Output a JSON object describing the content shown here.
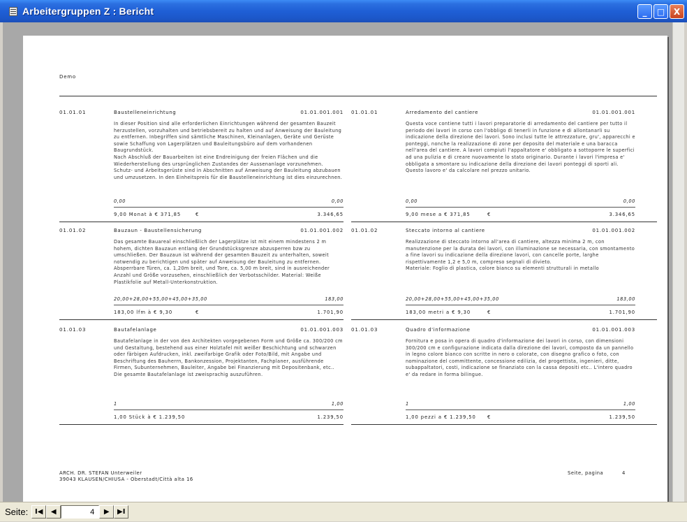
{
  "window": {
    "title": "Arbeitergruppen Z : Bericht",
    "buttons": {
      "minimize": "_",
      "maximize": "□",
      "close": "X"
    }
  },
  "report": {
    "header": "Demo",
    "rows": [
      {
        "left": {
          "code": "01.01.01",
          "title": "Baustelleneinrichtung",
          "ref": "01.01.001.001",
          "description": "In dieser Position sind alle erforderlichen Einrichtungen während der gesamten Bauzeit herzustellen, vorzuhalten und betriebsbereit zu halten und auf Anweisung der Bauleitung zu entfernen. Inbegriffen sind sämtliche Maschinen, Kleinanlagen, Geräte und Gerüste sowie Schaffung von Lagerplätzen und Bauleitungsbüro auf dem vorhandenen Baugrundstück.\nNach Abschluß der Bauarbeiten ist eine Endreinigung der freien Flächen und die Wiederherstellung des ursprünglichen Zustandes der Aussenanlage vorzunehmen. Schutz- und Arbeitsgerüste sind in Abschnitten auf Anweisung der Bauleitung abzubauen und umzusetzen. In den Einheitspreis für die Baustelleneinrichtung ist dies einzurechnen.",
          "calc": "0,00",
          "calc_value": "0,00",
          "summary": "9,00  Monat  à €  371,85",
          "euro": "€",
          "total": "3.346,65"
        },
        "right": {
          "code": "01.01.01",
          "title": "Arredamento del cantiere",
          "ref": "01.01.001.001",
          "description": "Questa voce contiene tutti i lavori preparatorie di arredamento del cantiere per tutto il periodo dei lavori in corso con l'obbligo di tenerli in funzione e di allontanarli su indicazione della direzione dei lavori. Sono inclusi tutte le attrezzature, gru', apparecchi e ponteggi, nonche la realizzazione di zone per deposito del materiale e una baracca nell'area del cantiere. A lavori compiuti l'appaltatore e' obbligato a sottoporre le superfici ad una pulizia e di creare nuovamente lo stato originario. Durante i lavori l'impresa e' obbligata a smontare su indicazione della direzione dei lavori ponteggi di sporti ali. Questo lavoro e' da calcolare nel prezzo unitario.",
          "calc": "0,00",
          "calc_value": "0,00",
          "summary": "9,00  mese  a €  371,85",
          "euro": "€",
          "total": "3.346,65"
        }
      },
      {
        "left": {
          "code": "01.01.02",
          "title": "Bauzaun - Baustellensicherung",
          "ref": "01.01.001.002",
          "description": "Das gesamte Bauareal einschließlich der Lagerplätze ist mit einem mindestens 2 m hohem, dichten Bauzaun entlang der Grundstücksgrenze abzusperren bzw zu umschließen. Der Bauzaun ist während der gesamten Bauzeit zu unterhalten, soweit notwendig zu berichtigen und später auf Anweisung der Bauleitung zu entfernen. Absperrbare Türen, ca. 1,20m breit, und Tore, ca. 5,00 m breit, sind in ausreichender Anzahl und Größe vorzusehen, einschließlich der Verbotsschilder. Material: Weiße Plastikfolie auf Metall-Unterkonstruktion.",
          "calc": "20,00+28,00+55,00+45,00+35,00",
          "calc_value": "183,00",
          "summary": "183,00  lfm  à €  9,30",
          "euro": "€",
          "total": "1.701,90"
        },
        "right": {
          "code": "01.01.02",
          "title": "Steccato intorno al cantiere",
          "ref": "01.01.001.002",
          "description": "Realizzazione di steccato intorno all'area di cantiere, altezza minima 2 m, con manutenzione per la durata dei lavori, con illuminazione se necessaria, con smontamento a fine lavori su indicazione della direzione lavori, con cancelle porte, larghe rispettivamente 1,2 e 5,0 m, compreso segnali di divieto.\nMateriale: Foglio di plastica, colore bianco su elementi strutturali in metallo",
          "calc": "20,00+28,00+55,00+45,00+35,00",
          "calc_value": "183,00",
          "summary": "183,00  metri  a €  9,30",
          "euro": "€",
          "total": "1.701,90"
        }
      },
      {
        "left": {
          "code": "01.01.03",
          "title": "Bautafelanlage",
          "ref": "01.01.001.003",
          "description": "Bautafelanlage in der von den Architekten vorgegebenen Form und Größe ca. 300/200 cm und Gestaltung, bestehend aus einer Holztafel mit weißer Beschichtung und schwarzen oder färbigen Aufdrucken, inkl. zweifarbige Grafik oder Foto/Bild, mit Angabe und Beschriftung des Bauherrn, Bankonzession, Projektanten, Fachplaner, ausführende Firmen, Subunternehmen, Bauleiter, Angabe bei Finanzierung mit Depositenbank, etc.. Die gesamte Bautafelanlage ist zweisprachig auszuführen.",
          "calc": "1",
          "calc_value": "1,00",
          "summary": "1,00  Stück  à €  1.239,50",
          "euro": "",
          "total": "1.239,50"
        },
        "right": {
          "code": "01.01.03",
          "title": "Quadro d'informazione",
          "ref": "01.01.001.003",
          "description": "Fornitura e posa in opera di quadro d'informazione dei lavori in corso, con dimensioni 300/200 cm e configurazione indicata dalla direzione dei lavori, composto da un pannello in legno colore bianco con scritte in nero o colorate, con disegno grafico o foto, con nominazione del committente, concessione edilizia, del progettista, ingenieri, ditte, subappaltatori, costi, indicazione se finanziato con la cassa depositi etc.. L'intero quadro e' da redare in forma bilingue.",
          "calc": "1",
          "calc_value": "1,00",
          "summary": "1,00  pezzi  a €  1.239,50",
          "euro": "€",
          "total": "1.239,50"
        }
      }
    ],
    "footer": {
      "line1": "ARCH. DR. STEFAN Unterweiler",
      "line2": "39043 KLAUSEN/CHIUSA - Oberstadt/Città alta 16",
      "page_label": "Seite, pagina",
      "page_number": "4"
    }
  },
  "navigation": {
    "label": "Seite:",
    "first": "I◀",
    "prev": "◀",
    "current_page": "4",
    "next": "▶",
    "last": "▶I"
  }
}
